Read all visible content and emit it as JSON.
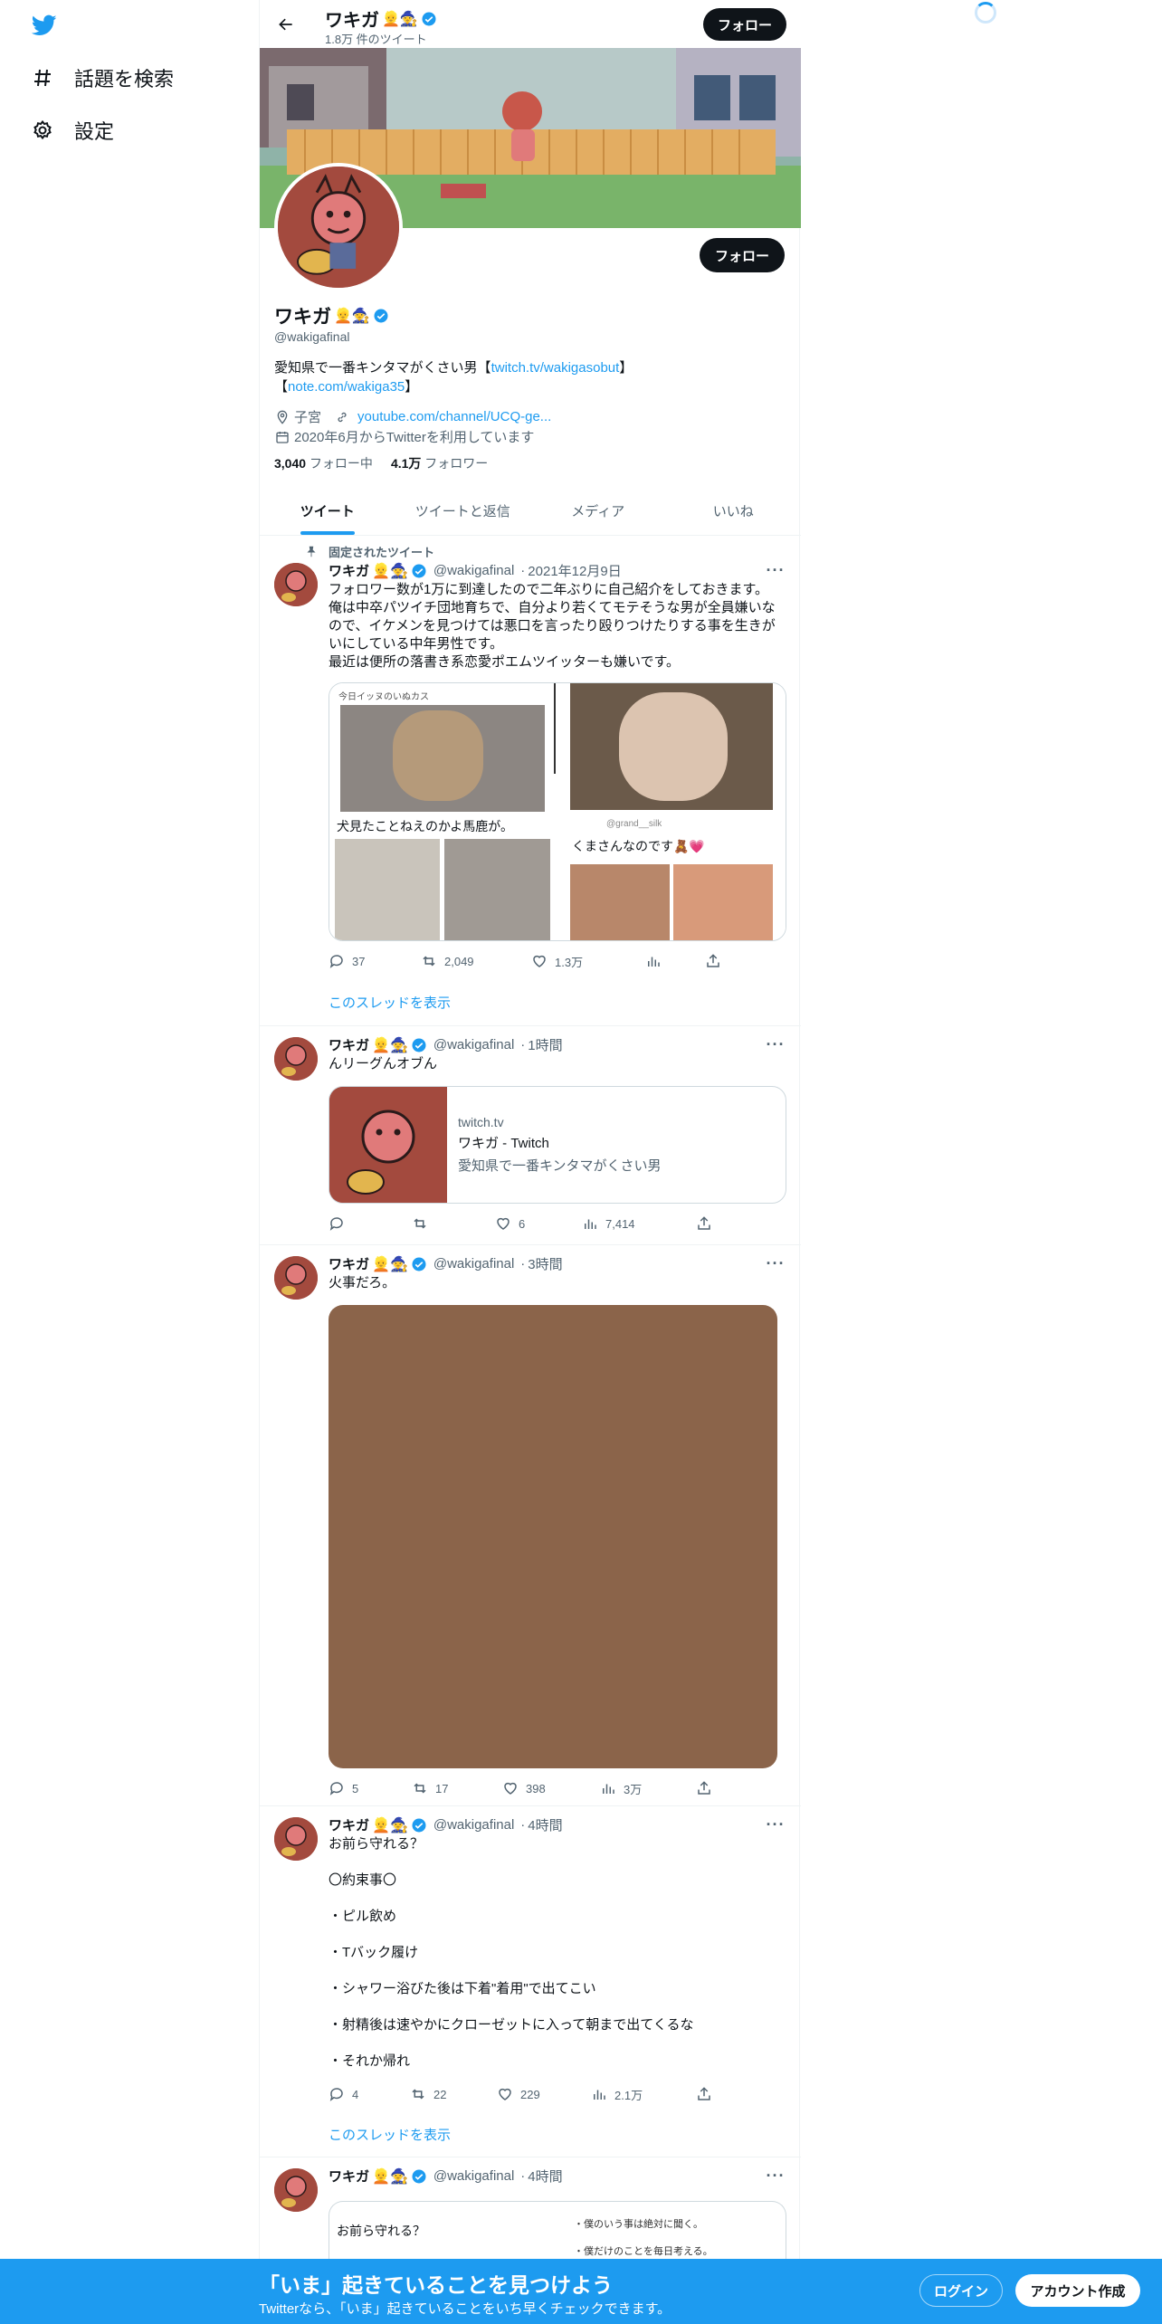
{
  "nav": {
    "explore_label": "話題を検索",
    "settings_label": "設定"
  },
  "header": {
    "name": "ワキガ",
    "emojis": "👱🧙",
    "tweet_count": "1.8万 件のツイート",
    "follow_label": "フォロー"
  },
  "profile": {
    "name": "ワキガ",
    "emojis": "👱🧙",
    "handle": "@wakigafinal",
    "follow_label": "フォロー",
    "bio_text_1": "愛知県で一番キンタマがくさい男【",
    "bio_link_1": "twitch.tv/wakigasobut",
    "bio_text_2": "】",
    "bio_text_3": "【",
    "bio_link_2": "note.com/wakiga35",
    "bio_text_4": "】",
    "location": "子宮",
    "website": "youtube.com/channel/UCQ-ge...",
    "joined": "2020年6月からTwitterを利用しています",
    "following_count": "3,040",
    "following_label": "フォロー中",
    "followers_count": "4.1万",
    "followers_label": "フォロワー"
  },
  "tabs": [
    "ツイート",
    "ツイートと返信",
    "メディア",
    "いいね"
  ],
  "pinned_label": "固定されたツイート",
  "tweets": [
    {
      "name": "ワキガ",
      "emojis": "👱🧙",
      "handle": "@wakigafinal",
      "time": "2021年12月9日",
      "text": "フォロワー数が1万に到達したので二年ぶりに自己紹介をしておきます。\n俺は中卒パツイチ団地育ちで、自分より若くてモテそうな男が全員嫌いなので、イケメンを見つけては悪口を言ったり殴りつけたりする事を生きがいにしている中年男性です。\n最近は便所の落書き系恋愛ポエムツイッターも嫌いです。",
      "media_left_caption": "犬見たことねえのかよ馬鹿が。",
      "media_left_header": "今日イッヌのいぬカス",
      "media_right_handle": "@grand__silk",
      "media_right_caption": "くまさんなのです🧸💗",
      "replies": "37",
      "retweets": "2,049",
      "likes": "1.3万",
      "views": "",
      "show_thread": "このスレッドを表示"
    },
    {
      "name": "ワキガ",
      "emojis": "👱🧙",
      "handle": "@wakigafinal",
      "time": "1時間",
      "text": "んリーグんオブん",
      "card_domain": "twitch.tv",
      "card_title": "ワキガ - Twitch",
      "card_desc": "愛知県で一番キンタマがくさい男",
      "replies": "",
      "retweets": "",
      "likes": "6",
      "views": "7,414"
    },
    {
      "name": "ワキガ",
      "emojis": "👱🧙",
      "handle": "@wakigafinal",
      "time": "3時間",
      "text": "火事だろ。",
      "replies": "5",
      "retweets": "17",
      "likes": "398",
      "views": "3万"
    },
    {
      "name": "ワキガ",
      "emojis": "👱🧙",
      "handle": "@wakigafinal",
      "time": "4時間",
      "text": "お前ら守れる？\n\n〇約束事〇\n\n・ピル飲め\n\n・Tバック履け\n\n・シャワー浴びた後は下着\"着用\"で出てこい\n\n・射精後は速やかにクローゼットに入って朝まで出てくるな\n\n・それか帰れ",
      "replies": "4",
      "retweets": "22",
      "likes": "229",
      "views": "2.1万",
      "show_thread": "このスレッドを表示"
    },
    {
      "name": "ワキガ",
      "emojis": "👱🧙",
      "handle": "@wakigafinal",
      "time": "4時間",
      "media_title": "お前ら守れる？",
      "media_line1": "・僕のいう事は絶対に聞く。",
      "media_line2": "・僕だけのことを毎日考える。"
    }
  ],
  "bottom_bar": {
    "title": "「いま」起きていることを見つけよう",
    "subtitle": "Twitterなら、「いま」起きていることをいち早くチェックできます。",
    "login_label": "ログイン",
    "signup_label": "アカウント作成"
  },
  "colors": {
    "accent": "#1d9bf0",
    "text": "#0f1419",
    "muted": "#536471"
  }
}
